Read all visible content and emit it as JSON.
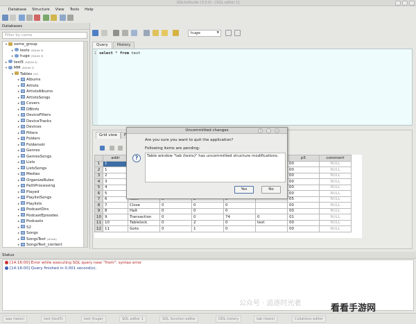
{
  "window": {
    "title": "SQLiteStudio (3.0.0) - [SQL editor 1]"
  },
  "menu": [
    "Database",
    "Structure",
    "View",
    "Tools",
    "Help"
  ],
  "databases_panel": {
    "header": "Databases",
    "filter_placeholder": "Filter by name",
    "tree": [
      {
        "label": "some_group",
        "type": "group",
        "level": 0,
        "arrow": "▾"
      },
      {
        "label": "testx",
        "sub": "(SQLite 3)",
        "type": "db",
        "level": 1,
        "arrow": "▸"
      },
      {
        "label": "huge",
        "sub": "(SQLite 3)",
        "type": "db",
        "level": 1,
        "arrow": "▸"
      },
      {
        "label": "test5",
        "sub": "(SQLite 3)",
        "type": "db",
        "level": 0,
        "arrow": "▸"
      },
      {
        "label": "MM",
        "sub": "(SQLite 3)",
        "type": "db",
        "level": 0,
        "arrow": "▾"
      },
      {
        "label": "Tables",
        "sub": "(47)",
        "type": "group",
        "level": 1,
        "arrow": "▾"
      },
      {
        "label": "Albums",
        "type": "table",
        "level": 2,
        "arrow": "▸"
      },
      {
        "label": "Artists",
        "type": "table",
        "level": 2,
        "arrow": "▸"
      },
      {
        "label": "ArtistsAlbums",
        "type": "table",
        "level": 2,
        "arrow": "▸"
      },
      {
        "label": "ArtistsSongs",
        "type": "table",
        "level": 2,
        "arrow": "▸"
      },
      {
        "label": "Covers",
        "type": "table",
        "level": 2,
        "arrow": "▸"
      },
      {
        "label": "DBInfo",
        "type": "table",
        "level": 2,
        "arrow": "▸"
      },
      {
        "label": "DeviceFilters",
        "type": "table",
        "level": 2,
        "arrow": "▸"
      },
      {
        "label": "DeviceTracks",
        "type": "table",
        "level": 2,
        "arrow": "▸"
      },
      {
        "label": "Devices",
        "type": "table",
        "level": 2,
        "arrow": "▸"
      },
      {
        "label": "Filters",
        "type": "table",
        "level": 2,
        "arrow": "▸"
      },
      {
        "label": "Folders",
        "type": "table",
        "level": 2,
        "arrow": "▸"
      },
      {
        "label": "Foldersstr",
        "type": "table",
        "level": 2,
        "arrow": "▸"
      },
      {
        "label": "Genres",
        "type": "table",
        "level": 2,
        "arrow": "▸"
      },
      {
        "label": "GenresSongs",
        "type": "table",
        "level": 2,
        "arrow": "▸"
      },
      {
        "label": "Lists",
        "type": "table",
        "level": 2,
        "arrow": "▸"
      },
      {
        "label": "ListsSongs",
        "type": "table",
        "level": 2,
        "arrow": "▸"
      },
      {
        "label": "Medias",
        "type": "table",
        "level": 2,
        "arrow": "▸"
      },
      {
        "label": "OrganizeRules",
        "type": "table",
        "level": 2,
        "arrow": "▸"
      },
      {
        "label": "PathProcessing",
        "type": "table",
        "level": 2,
        "arrow": "▸"
      },
      {
        "label": "Played",
        "type": "table",
        "level": 2,
        "arrow": "▸"
      },
      {
        "label": "PlaylistSongs",
        "type": "table",
        "level": 2,
        "arrow": "▸"
      },
      {
        "label": "Playlists",
        "type": "table",
        "level": 2,
        "arrow": "▸"
      },
      {
        "label": "PodcastDirs",
        "type": "table",
        "level": 2,
        "arrow": "▸"
      },
      {
        "label": "PodcastEpisodes",
        "type": "table",
        "level": 2,
        "arrow": "▸"
      },
      {
        "label": "Podcasts",
        "type": "table",
        "level": 2,
        "arrow": "▸"
      },
      {
        "label": "S2",
        "type": "table",
        "level": 2,
        "arrow": "▸"
      },
      {
        "label": "Songs",
        "type": "table",
        "level": 2,
        "arrow": "▸"
      },
      {
        "label": "SongsText",
        "sub": "(virtual)",
        "type": "table",
        "level": 2,
        "arrow": "▸"
      },
      {
        "label": "SongsText_content",
        "type": "table",
        "level": 2,
        "arrow": "▸"
      }
    ]
  },
  "toolbar": {
    "db_select": "huge"
  },
  "editor": {
    "tabs": [
      "Query",
      "History"
    ],
    "active_tab": "Query",
    "line_number": "1",
    "code_keyword1": "select",
    "code_mid": " * ",
    "code_keyword2": "from",
    "code_rest": " test"
  },
  "results": {
    "tabs": [
      "Grid view",
      "For"
    ],
    "active_tab": "Grid view",
    "columns": [
      "",
      "addr",
      "",
      "",
      "",
      "",
      "p5",
      "comment"
    ],
    "rows": [
      [
        "1",
        "1",
        "",
        "",
        "",
        "",
        "00",
        "NULL"
      ],
      [
        "2",
        "1",
        "",
        "",
        "",
        "",
        "00",
        "NULL"
      ],
      [
        "3",
        "2",
        "",
        "",
        "",
        "",
        "00",
        "NULL"
      ],
      [
        "4",
        "3",
        "",
        "",
        "",
        "",
        "00",
        "NULL"
      ],
      [
        "5",
        "4",
        "",
        "",
        "",
        "",
        "00",
        "NULL"
      ],
      [
        "6",
        "5",
        "",
        "",
        "",
        "",
        "00",
        "NULL"
      ],
      [
        "7",
        "6",
        "Next",
        "0",
        "3",
        "0",
        "05",
        "NULL"
      ],
      [
        "8",
        "7",
        "Close",
        "0",
        "0",
        "0",
        "00",
        "NULL"
      ],
      [
        "9",
        "8",
        "Halt",
        "0",
        "0",
        "0",
        "00",
        "NULL"
      ],
      [
        "10",
        "9",
        "Transaction",
        "0",
        "0",
        "74",
        "0",
        "01",
        "NULL"
      ],
      [
        "11",
        "10",
        "Tablelock",
        "0",
        "2",
        "0",
        "test",
        "00",
        "NULL"
      ],
      [
        "12",
        "11",
        "Goto",
        "0",
        "1",
        "0",
        "",
        "00",
        "NULL"
      ]
    ]
  },
  "dialog": {
    "title": "Uncommitted changes",
    "question": "Are you sure you want to quit the application?",
    "pending_label": "Following items are pending:",
    "items": [
      "Table window \"tab (testx)\" has uncommitted structure modifications."
    ],
    "yes_label": "Yes",
    "no_label": "No"
  },
  "status": {
    "header": "Status",
    "lines": [
      {
        "time": "[14:16:00]",
        "text": "Error while executing SQL query near \"from\": syntax error",
        "kind": "error"
      },
      {
        "time": "[14:16:00]",
        "text": "Query finished in 0.001 second(s).",
        "kind": "info"
      }
    ]
  },
  "taskbar": [
    "aaa (testx)",
    "test (test5)",
    "test (huge)",
    "SQL editor 1",
    "SQL function editor",
    "DDL history",
    "tab (testx)",
    "Collations editor"
  ],
  "watermark": {
    "text1": "公众号 · 追逐时光者",
    "logo": "看看手游网"
  },
  "colors": {
    "accent": "#3d6ea5",
    "error": "#b32222",
    "editor_bg": "#eefcfd"
  }
}
